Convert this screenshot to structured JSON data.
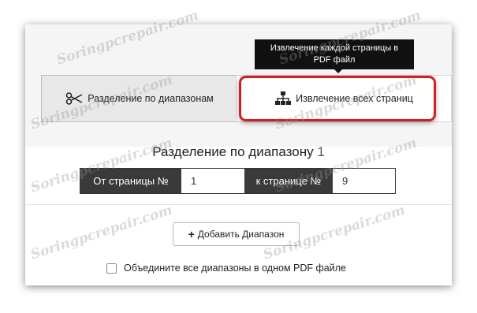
{
  "watermark": "Soringpcrepair.com",
  "tabs": {
    "split_label": "Разделение по диапазонам",
    "extract_label": "Извлечение всех страниц"
  },
  "tooltip": {
    "line1": "Извлечение каждой страницы в",
    "line2": "PDF файл"
  },
  "range": {
    "title": "Разделение по диапазону",
    "number": "1",
    "from_label": "От страницы №",
    "from_value": "1",
    "to_label": "к странице №",
    "to_value": "9"
  },
  "add_range_label": "Добавить Диапазон",
  "merge_label": "Объедините все диапазоны в одном PDF файле",
  "colors": {
    "highlight": "#d51f1f",
    "dark_label": "#3a3a3a",
    "tooltip_bg": "#111111"
  }
}
